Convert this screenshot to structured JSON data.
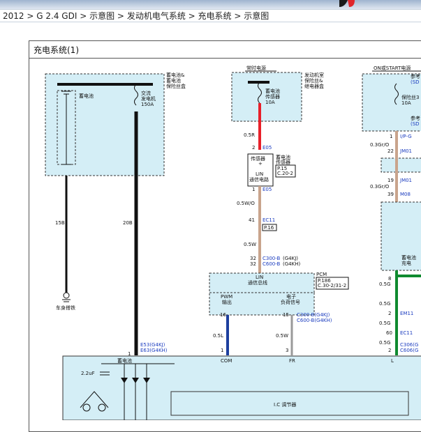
{
  "breadcrumb": {
    "items": [
      "2012",
      "G 2.4 GDI",
      "示意图",
      "发动机电气系统",
      "充电系统",
      "示意图"
    ],
    "separator": ">"
  },
  "diagram": {
    "title": "充电系统(1)",
    "left_box": {
      "label": "蓄电池&\n蓄电池\n保险丝盒",
      "battery": "蓄电池",
      "fuse": "交流\n发电机\n150A",
      "wire_l": "15B",
      "wire_r": "20B",
      "ground": "车身搭铁"
    },
    "center_box": {
      "header": "常时电源",
      "label": "发动机室\n保险丝&\n继电器盒",
      "fuse": "蓄电池\n传感器\n10A"
    },
    "right_box": {
      "header": "ON或START电源",
      "fuse": "保险丝3\n10A",
      "ref1": "参考",
      "ref1b": "(SD",
      "ref2": "参考",
      "ref2b": "(SD"
    },
    "sensor": {
      "label": "传感器\n+",
      "lin": "LIN\n通信电路",
      "name": "蓄电池\n传感器",
      "ref": "P.15\nC.20-2"
    },
    "wires": {
      "w1": "0.5R",
      "w1_pin": "2",
      "w1_conn": "E05",
      "w2_pin": "1",
      "w2_conn": "E05",
      "w2": "0.5W/O",
      "ec11": "EC11",
      "ec11_pin": "41",
      "ec11_ref": "P.16",
      "w3": "0.5W",
      "c300_pin1": "32",
      "c300_pin2": "32",
      "c300": "C300-B",
      "c600": "C600-B",
      "g4kj": "(G4KJ)",
      "g4kh": "(G4KH)"
    },
    "pcm": {
      "name": "PCM",
      "ref": "P.186\nC.30-2/31-2",
      "lin": "LIN\n通信总线",
      "pwm": "PWM\n输出",
      "load": "电子\n负荷信号",
      "pin16": "16",
      "pin15": "15",
      "w_pwm": "0.5L",
      "w_load": "0.5W",
      "conn_a": "C300-B(G4KJ)",
      "conn_b": "C600-B(G4KH)"
    },
    "right_wires": {
      "ipg_pin": "1",
      "ipg": "I/P-G",
      "w_ipg": "0.3Gr/O",
      "jm01_pin": "22",
      "jm01": "JM01",
      "jm01b_pin": "19",
      "jm01b": "JM01",
      "w_m08": "0.3Gr/O",
      "m08_pin": "39",
      "m08": "M08",
      "batt": "蓄电池\n充电",
      "p8": "8",
      "w_8": "0.5G",
      "p2": "2",
      "em11": "EM11",
      "em11_ref": "P",
      "p60": "60",
      "ec11": "EC11",
      "ec11_ref": "P",
      "p2b": "2",
      "c306": "C306(G",
      "c606": "C606(G",
      "w_2": "0.5G",
      "w_60": "0.5G",
      "w_2b": "0.5G",
      "alt_ref": "交\nP.\nC."
    },
    "alternator": {
      "pin": "1",
      "e53": "E53(G4KJ)",
      "e63": "E63(G4KH)",
      "batt": "蓄电池",
      "cap": "2.2uF",
      "com": "COM",
      "fr": "FR",
      "l": "L",
      "pin1": "1",
      "pin3": "3",
      "pin2": "2",
      "regulator": "I.C 调节器"
    }
  },
  "colors": {
    "red": "#e8202a",
    "black": "#111111",
    "brown": "#c9a48c",
    "blue": "#1d3f9e",
    "green": "#0f8a2f",
    "gray": "#9a9a9a",
    "boxfill": "#d4eef6"
  }
}
